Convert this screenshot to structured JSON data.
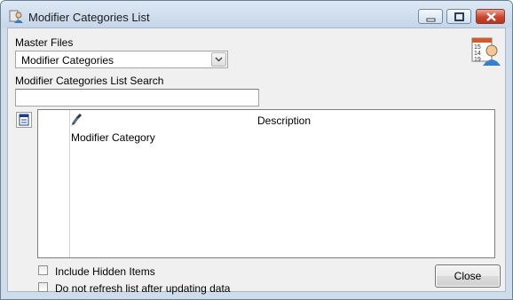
{
  "window": {
    "title": "Modifier Categories List",
    "controls": {
      "minimize_icon": "minimize-icon",
      "maximize_icon": "maximize-icon",
      "close_icon": "close-icon"
    }
  },
  "master_files": {
    "label": "Master Files",
    "selected": "Modifier Categories"
  },
  "search": {
    "label": "Modifier Categories List Search",
    "value": "",
    "placeholder": ""
  },
  "grid": {
    "columns": [
      "Description"
    ],
    "rows": [
      {
        "description": "Modifier Category"
      }
    ]
  },
  "options": {
    "include_hidden": {
      "label": "Include Hidden Items",
      "checked": false
    },
    "no_refresh": {
      "label": "Do not refresh list after updating data",
      "checked": false
    }
  },
  "buttons": {
    "close": "Close"
  },
  "colors": {
    "title_bg": "#c6d6e9",
    "client_bg": "#f0f0f0",
    "close_button_red": "#c9452f"
  }
}
